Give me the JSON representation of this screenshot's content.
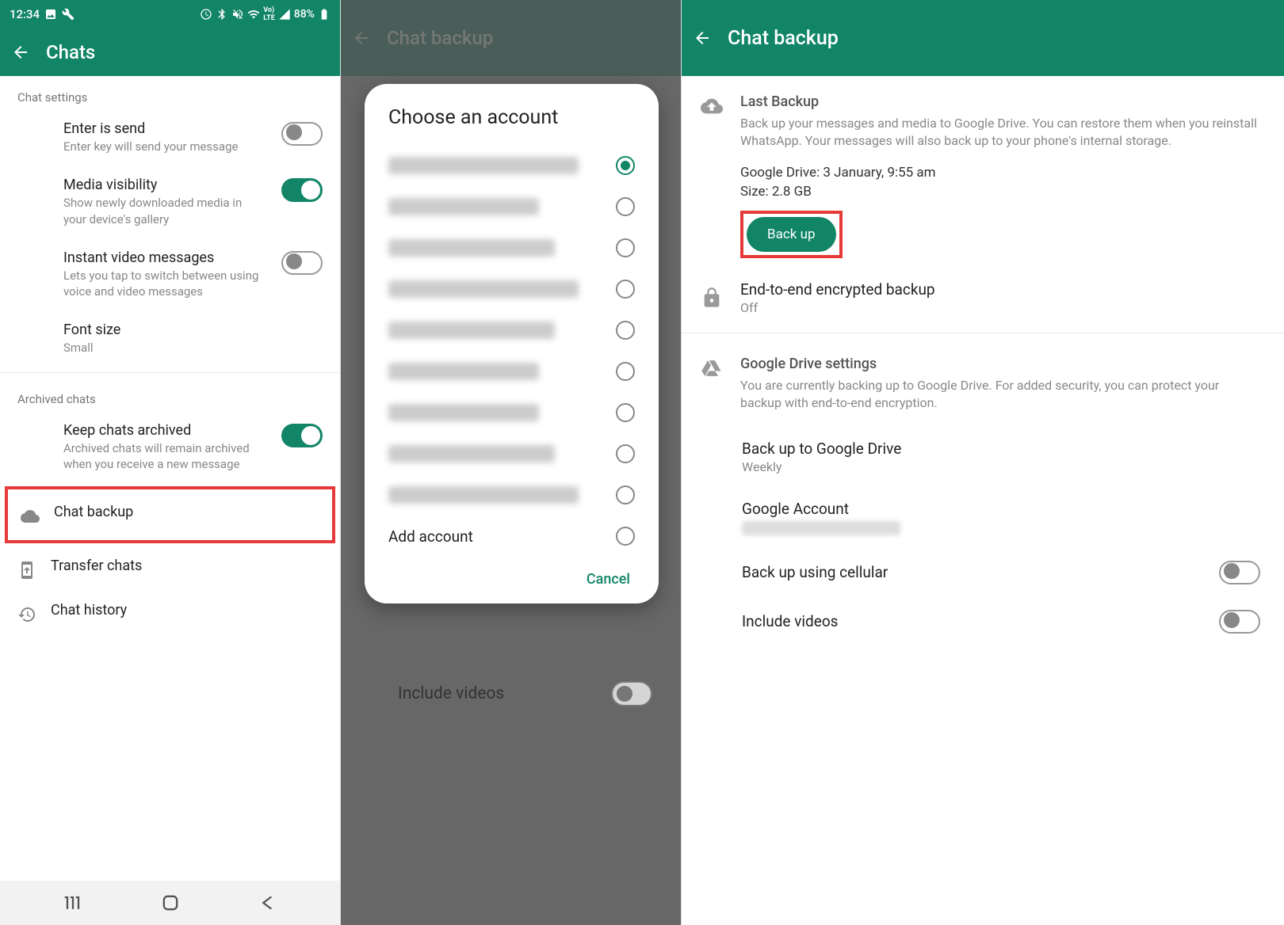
{
  "status": {
    "time": "12:34",
    "battery": "88%"
  },
  "panel1": {
    "title": "Chats",
    "section1": "Chat settings",
    "items": {
      "enter_send": {
        "title": "Enter is send",
        "sub": "Enter key will send your message"
      },
      "media_vis": {
        "title": "Media visibility",
        "sub": "Show newly downloaded media in your device's gallery"
      },
      "instant_vid": {
        "title": "Instant video messages",
        "sub": "Lets you tap to switch between using voice and video messages"
      },
      "font_size": {
        "title": "Font size",
        "sub": "Small"
      }
    },
    "section2": "Archived chats",
    "keep_archived": {
      "title": "Keep chats archived",
      "sub": "Archived chats will remain archived when you receive a new message"
    },
    "chat_backup": "Chat backup",
    "transfer": "Transfer chats",
    "history": "Chat history"
  },
  "panel2": {
    "title": "Chat backup",
    "dialog_title": "Choose an account",
    "add_account": "Add account",
    "cancel": "Cancel",
    "include_videos": "Include videos"
  },
  "panel3": {
    "title": "Chat backup",
    "last_backup": {
      "heading": "Last Backup",
      "desc": "Back up your messages and media to Google Drive. You can restore them when you reinstall WhatsApp. Your messages will also back up to your phone's internal storage.",
      "drive_line": "Google Drive: 3 January, 9:55 am",
      "size_line": "Size: 2.8 GB",
      "button": "Back up"
    },
    "e2e": {
      "title": "End-to-end encrypted backup",
      "sub": "Off"
    },
    "gd_settings": {
      "heading": "Google Drive settings",
      "desc": "You are currently backing up to Google Drive. For added security, you can protect your backup with end-to-end encryption."
    },
    "freq": {
      "title": "Back up to Google Drive",
      "sub": "Weekly"
    },
    "account": {
      "title": "Google Account"
    },
    "cellular": "Back up using cellular",
    "include_videos": "Include videos"
  }
}
